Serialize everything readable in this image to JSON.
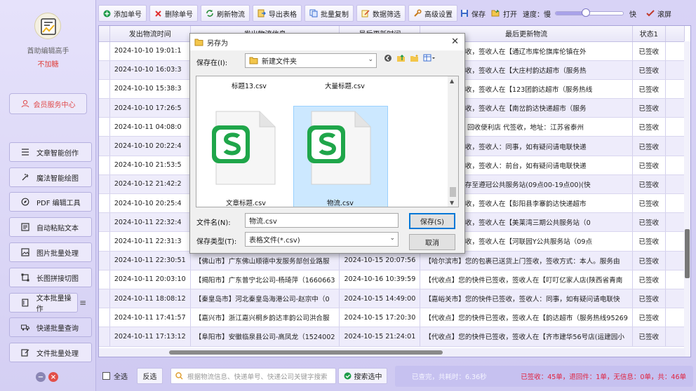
{
  "sidebar": {
    "app_name": "酋助编辑高手",
    "app_sub": "不加糖",
    "member_label": "会员服务中心",
    "items": [
      {
        "label": "文章智能创作"
      },
      {
        "label": "魔法智能绘图"
      },
      {
        "label": "PDF 编辑工具"
      },
      {
        "label": "自动粘贴文本"
      },
      {
        "label": "图片批量处理"
      },
      {
        "label": "长图拼接切图"
      },
      {
        "label": "文本批量操作"
      },
      {
        "label": "快递批量查询"
      },
      {
        "label": "文件批量处理"
      }
    ]
  },
  "toolbar": {
    "add": "添加单号",
    "delete": "删除单号",
    "refresh": "刷新物流",
    "export": "导出表格",
    "batch_copy": "批量复制",
    "filter": "数据筛选",
    "advanced": "高级设置",
    "save": "保存",
    "open": "打开",
    "speed_label": "速度：慢",
    "speed_level": 0.45,
    "fast_label": "快",
    "scroll_label": "滚屏"
  },
  "table": {
    "headers": [
      "",
      "发出物流时间",
      "发出物流信息",
      "最后更新时间",
      "最后更新物流",
      "状态1",
      ""
    ],
    "rows": [
      [
        "",
        "2024-10-10 19:01:1",
        "",
        "",
        "您的快件已签收，签收人在【通辽市库伦旗库伦镇在外",
        "已签收",
        ""
      ],
      [
        "",
        "2024-10-10 16:03:3",
        "",
        "",
        "您的快件已签收，签收人在【大庄村韵达超市（服务热",
        "已签收",
        ""
      ],
      [
        "",
        "2024-10-10 15:38:3",
        "",
        "",
        "您的快件已签收，签收人在【123团韵达超市（服务热线",
        "已签收",
        ""
      ],
      [
        "",
        "2024-10-10 17:26:5",
        "",
        "",
        "您的快件已签收，签收人在【南岔韵达快递超市（服务",
        "已签收",
        ""
      ],
      [
        "",
        "2024-10-11 04:08:0",
        "",
        "",
        "您的快件已被 回收便利店 代签收，地址：江苏省泰州",
        "已签收",
        ""
      ],
      [
        "",
        "2024-10-10 20:22:4",
        "",
        "",
        "您的快件已签收，签收人：同事，如有疑问请电联快递",
        "已签收",
        ""
      ],
      [
        "",
        "2024-10-10 21:53:5",
        "",
        "",
        "您的快件已签收，签收人：前台，如有疑问请电联快递",
        "已签收",
        ""
      ],
      [
        "",
        "2024-10-12 21:42:2",
        "",
        "",
        "您的快件已暂存至遵冠公共服务站(09点00-19点00)(快",
        "已签收",
        ""
      ],
      [
        "",
        "2024-10-10 20:25:4",
        "",
        "",
        "您的快件已签收，签收人在【彭阳县李寨韵达快递超市",
        "已签收",
        ""
      ],
      [
        "",
        "2024-10-11 22:32:4",
        "",
        "",
        "您的快件已签收，签收人在【美莱湾三期公共服务站（0",
        "已签收",
        ""
      ],
      [
        "",
        "2024-10-11 22:31:3",
        "",
        "",
        "您的快件已签收，签收人在【河联园Y公共服务站（09点",
        "已签收",
        ""
      ],
      [
        "",
        "2024-10-11 22:30:51",
        "【佛山市】广东佛山顺德中发服务部创业路服",
        "2024-10-15 20:07:56",
        "【哈尔滨市】您的包裹已送货上门签收，签收方式：本人。服务由",
        "已签收",
        ""
      ],
      [
        "",
        "2024-10-11 20:03:10",
        "【揭阳市】广东普宁北公司-杨琦萍（1660663",
        "2024-10-16 10:39:59",
        "【代收点】您的快件已签收，签收人在【叮叮亿家人店(陕西省青南",
        "已签收",
        ""
      ],
      [
        "",
        "2024-10-11 18:08:12",
        "【秦皇岛市】河北秦皇岛海港公司-赵宗中（0",
        "2024-10-15 14:49:00",
        "【嘉峪关市】您的快件已签收，签收人：同事，如有疑问请电联快",
        "已签收",
        ""
      ],
      [
        "",
        "2024-10-11 17:41:57",
        "【嘉兴市】浙江嘉兴桐乡韵达丰韵公司洪合服",
        "2024-10-15 17:20:30",
        "【代收点】您的快件已签收，签收人在【韵达超市（服务热线95269",
        "已签收",
        ""
      ],
      [
        "",
        "2024-10-11 17:13:12",
        "【阜阳市】安徽临泉县公司-高凤龙（1524002",
        "2024-10-15 21:24:01",
        "【代收点】您的快件已签收，签收人在【齐市建华56号店(运建园小",
        "已签收",
        ""
      ]
    ]
  },
  "bottom": {
    "select_all": "全选",
    "invert": "反选",
    "search_placeholder": "根据物流信息、快递单号、快递公司关键字搜索",
    "search_button": "搜索选中",
    "info_left": "已查完，共耗时：6.36秒",
    "info_right": "已签收：45单，退回件：1单，无信息：0单，共：46单"
  },
  "dialog": {
    "title": "另存为",
    "save_in_label": "保存在(I):",
    "save_in_value": "新建文件夹",
    "files": [
      "标题13.csv",
      "大量标题.csv",
      "文章标题.csv",
      "物流.csv"
    ],
    "filename_label": "文件名(N):",
    "filename_value": "物流.csv",
    "filetype_label": "保存类型(T):",
    "filetype_value": "表格文件(*.csv)",
    "save_button": "保存(S)",
    "cancel_button": "取消"
  },
  "colors": {
    "accent": "#7d77c4",
    "csv_green": "#1fa64a",
    "status_red": "#e0213e"
  }
}
